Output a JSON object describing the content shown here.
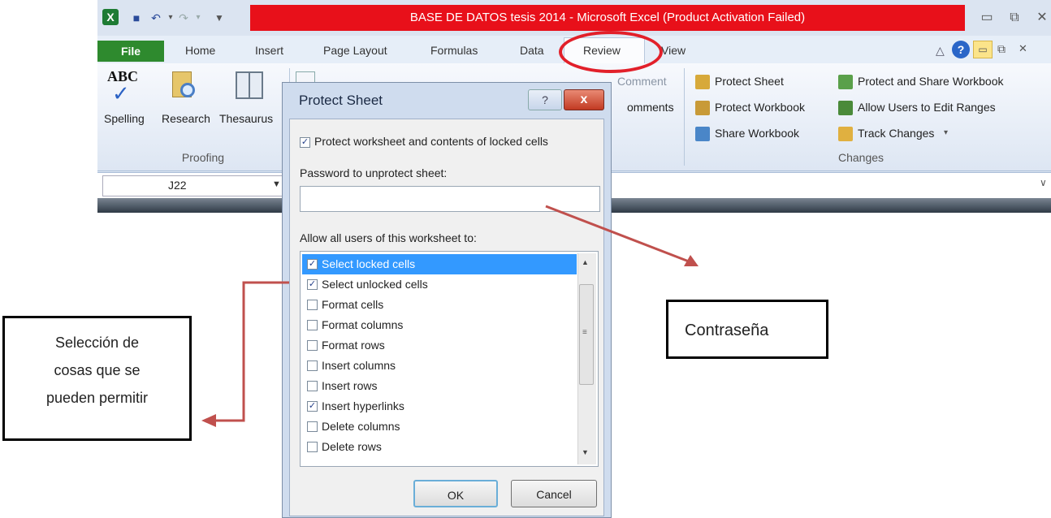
{
  "window": {
    "title": "BASE DE DATOS tesis 2014 -  Microsoft Excel (Product Activation Failed)"
  },
  "tabs": [
    "File",
    "Home",
    "Insert",
    "Page Layout",
    "Formulas",
    "Data",
    "Review",
    "View"
  ],
  "ribbon": {
    "proofing": {
      "spelling": "Spelling",
      "research": "Research",
      "thesaurus": "Thesaurus",
      "group_label": "Proofing"
    },
    "comments": {
      "comment_partial": "Comment",
      "comments_partial": "omments"
    },
    "changes": {
      "protect_sheet": "Protect Sheet",
      "protect_workbook": "Protect Workbook",
      "share_workbook": "Share Workbook",
      "protect_share": "Protect and Share Workbook",
      "allow_users": "Allow Users to Edit Ranges",
      "track_changes": "Track Changes",
      "group_label": "Changes"
    }
  },
  "name_box": "J22",
  "dialog": {
    "title": "Protect Sheet",
    "help": "?",
    "close": "x",
    "protect_label": "Protect worksheet and contents of locked cells",
    "password_label": "Password to unprotect sheet:",
    "password_value": "",
    "allow_label": "Allow all users of this worksheet to:",
    "permissions": [
      {
        "label": "Select locked cells",
        "checked": true,
        "selected": true
      },
      {
        "label": "Select unlocked cells",
        "checked": true,
        "selected": false
      },
      {
        "label": "Format cells",
        "checked": false,
        "selected": false
      },
      {
        "label": "Format columns",
        "checked": false,
        "selected": false
      },
      {
        "label": "Format rows",
        "checked": false,
        "selected": false
      },
      {
        "label": "Insert columns",
        "checked": false,
        "selected": false
      },
      {
        "label": "Insert rows",
        "checked": false,
        "selected": false
      },
      {
        "label": "Insert hyperlinks",
        "checked": true,
        "selected": false
      },
      {
        "label": "Delete columns",
        "checked": false,
        "selected": false
      },
      {
        "label": "Delete rows",
        "checked": false,
        "selected": false
      }
    ],
    "ok": "OK",
    "cancel": "Cancel"
  },
  "annotations": {
    "left_line1": "Selección  de",
    "left_line2": "cosas que se",
    "left_line3": "pueden permitir",
    "right": "Contraseña",
    "arrow_color": "#c0504d",
    "circle_color": "#e2202a"
  }
}
